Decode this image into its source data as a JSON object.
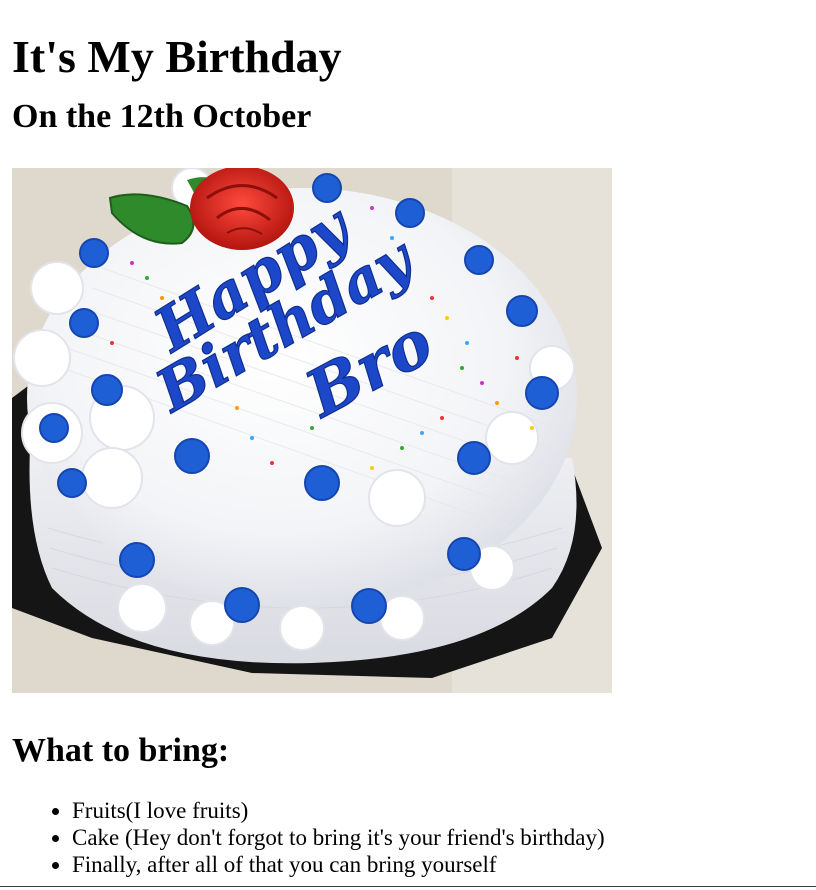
{
  "page": {
    "title": "It's My Birthday",
    "date_heading": "On the 12th October",
    "cake_image": {
      "text_lines": [
        "Happy",
        "Birthday",
        "Bro"
      ],
      "colors": {
        "background": "#ded8cd",
        "frosting": "#f7f7f9",
        "rosette_blue": "#1f5fd6",
        "script_blue": "#1c47c9",
        "rose_red": "#d6231e",
        "leaf_green": "#2e8a2a",
        "board_black": "#151515"
      }
    },
    "bring_heading": "What to bring:",
    "bring_items": [
      "Fruits(I love fruits)",
      "Cake (Hey don't forgot to bring it's your friend's birthday)",
      "Finally, after all of that you can bring yourself"
    ]
  }
}
